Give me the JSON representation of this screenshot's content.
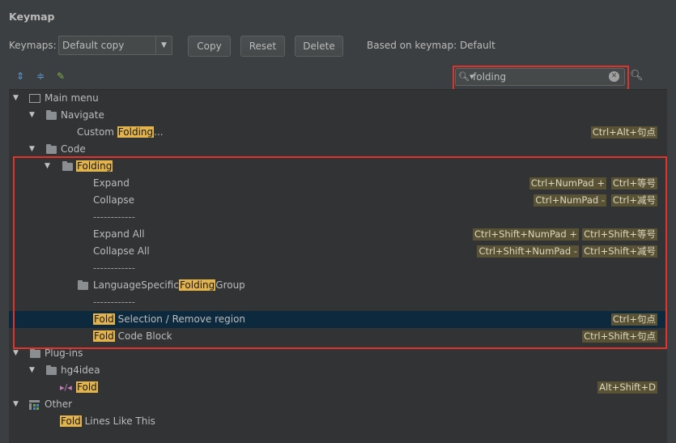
{
  "dialog_title": "Keymap",
  "keymaps_label": "Keymaps:",
  "keymap_selected": "Default copy",
  "buttons": {
    "copy": "Copy",
    "reset": "Reset",
    "delete": "Delete"
  },
  "based_on": "Based on keymap: Default",
  "search": {
    "value": "folding"
  },
  "tree": {
    "main_menu": "Main menu",
    "navigate": "Navigate",
    "custom_folding": {
      "prefix": "Custom ",
      "match": "Folding",
      "suffix": "...",
      "shortcut": "Ctrl+Alt+句点"
    },
    "code": "Code",
    "folding_group": "Folding",
    "expand": {
      "label": "Expand",
      "shortcuts": [
        "Ctrl+NumPad +",
        "Ctrl+等号"
      ]
    },
    "collapse": {
      "label": "Collapse",
      "shortcuts": [
        "Ctrl+NumPad -",
        "Ctrl+减号"
      ]
    },
    "separator": "------------",
    "expand_all": {
      "label": "Expand All",
      "shortcuts": [
        "Ctrl+Shift+NumPad +",
        "Ctrl+Shift+等号"
      ]
    },
    "collapse_all": {
      "label": "Collapse All",
      "shortcuts": [
        "Ctrl+Shift+NumPad -",
        "Ctrl+Shift+减号"
      ]
    },
    "lang_group": {
      "prefix": "LanguageSpecific",
      "match": "Folding",
      "suffix": "Group"
    },
    "fold_selection": {
      "match": "Fold",
      "suffix": " Selection / Remove region",
      "shortcut": "Ctrl+句点"
    },
    "fold_code_block": {
      "match": "Fold",
      "suffix": " Code Block",
      "shortcut": "Ctrl+Shift+句点"
    },
    "plugins": "Plug-ins",
    "hg4idea": "hg4idea",
    "hg_fold": {
      "match": "Fold",
      "shortcut": "Alt+Shift+D"
    },
    "other": "Other",
    "fold_lines": {
      "match": "Fold",
      "suffix": " Lines Like This"
    }
  },
  "colors": {
    "highlight_box": "#e0332b",
    "match": "#e3b44c",
    "selection": "#0d293e"
  }
}
